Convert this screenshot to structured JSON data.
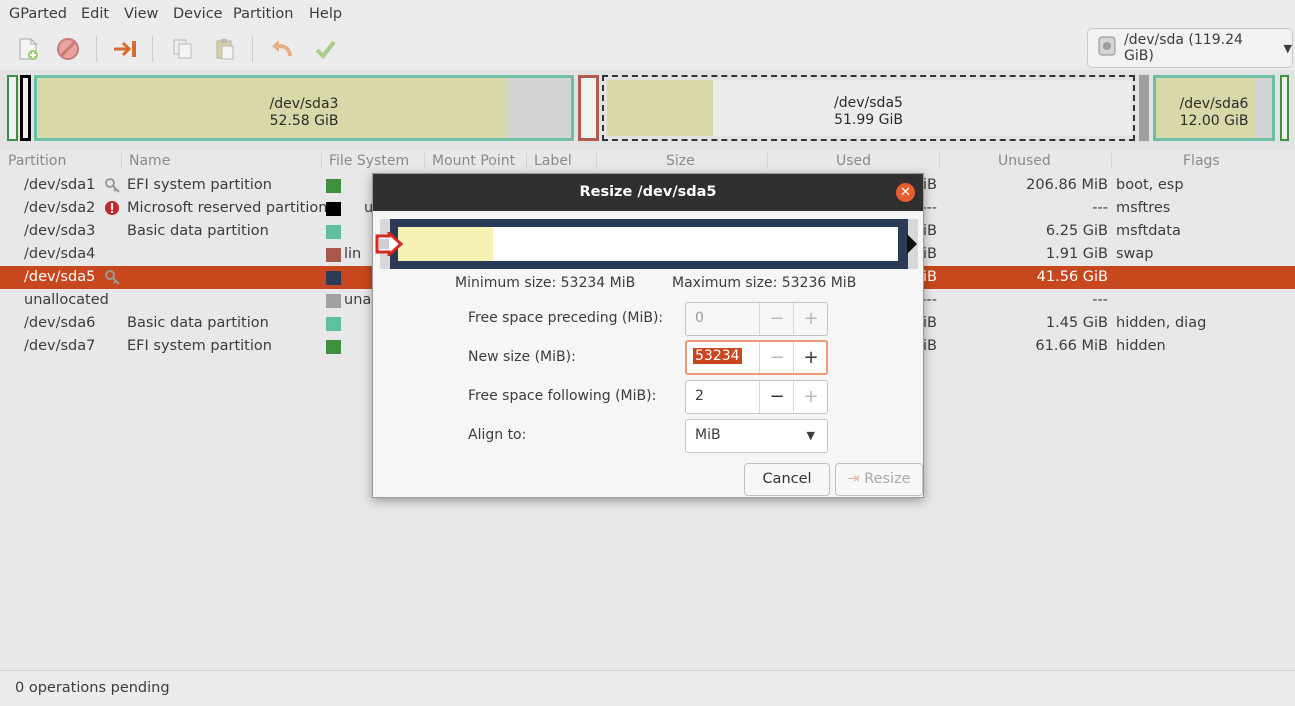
{
  "menu": [
    "GParted",
    "Edit",
    "View",
    "Device",
    "Partition",
    "Help"
  ],
  "toolbar": {
    "icons": [
      "new-icon",
      "delete-icon",
      "resize-move-icon",
      "copy-icon",
      "paste-icon",
      "undo-icon",
      "apply-icon"
    ]
  },
  "device_selector": {
    "label": "/dev/sda (119.24 GiB)"
  },
  "disk_map": {
    "sda3": {
      "name": "/dev/sda3",
      "size": "52.58 GiB"
    },
    "sda5": {
      "name": "/dev/sda5",
      "size": "51.99 GiB"
    },
    "sda6": {
      "name": "/dev/sda6",
      "size": "12.00 GiB"
    }
  },
  "table": {
    "headers": [
      "Partition",
      "Name",
      "File System",
      "Mount Point",
      "Label",
      "Size",
      "Used",
      "Unused",
      "Flags"
    ],
    "rows": [
      {
        "partition": "/dev/sda1",
        "icon": "key-icon",
        "name": "EFI system partition",
        "fs_color": "#3f8f3f",
        "fs": "",
        "used_frag": "iB",
        "unused": "206.86 MiB",
        "flags": "boot, esp"
      },
      {
        "partition": "/dev/sda2",
        "icon": "warning-icon",
        "name": "Microsoft reserved partition",
        "fs_color": "#000000",
        "fs": "u",
        "used_frag": "---",
        "unused": "---",
        "flags": "msftres"
      },
      {
        "partition": "/dev/sda3",
        "icon": "",
        "name": "Basic data partition",
        "fs_color": "#5fbf9f",
        "fs": "",
        "used_frag": "iB",
        "unused": "6.25 GiB",
        "flags": "msftdata"
      },
      {
        "partition": "/dev/sda4",
        "icon": "",
        "name": "",
        "fs_color": "#a85a4a",
        "fs": "lin",
        "used_frag": "iB",
        "unused": "1.91 GiB",
        "flags": "swap"
      },
      {
        "partition": "/dev/sda5",
        "icon": "key-icon",
        "name": "",
        "fs_color": "#2b3a57",
        "fs": "",
        "used_frag": "iB",
        "unused": "41.56 GiB",
        "flags": ""
      },
      {
        "partition": "unallocated",
        "icon": "",
        "name": "",
        "fs_color": "#a0a0a0",
        "fs": "unal",
        "used_frag": "---",
        "unused": "---",
        "flags": ""
      },
      {
        "partition": "/dev/sda6",
        "icon": "",
        "name": "Basic data partition",
        "fs_color": "#5fbf9f",
        "fs": "",
        "used_frag": "iB",
        "unused": "1.45 GiB",
        "flags": "hidden, diag"
      },
      {
        "partition": "/dev/sda7",
        "icon": "",
        "name": "EFI system partition",
        "fs_color": "#3f8f3f",
        "fs": "",
        "used_frag": "iB",
        "unused": "61.66 MiB",
        "flags": "hidden"
      }
    ],
    "selected_index": 4
  },
  "status": "0 operations pending",
  "dialog": {
    "title": "Resize /dev/sda5",
    "used_fraction": 0.19,
    "min_size": "Minimum size: 53234 MiB",
    "max_size": "Maximum size: 53236 MiB",
    "fields": [
      {
        "label": "Free space preceding (MiB):",
        "value": "0"
      },
      {
        "label": "New size (MiB):",
        "value": "53234"
      },
      {
        "label": "Free space following (MiB):",
        "value": "2"
      },
      {
        "label": "Align to:",
        "value": "MiB"
      }
    ],
    "cancel_label": "Cancel",
    "resize_label": "Resize"
  },
  "colors": {
    "accent": "#c7471e",
    "used_fill": "#d6d6a5",
    "ntfs": "#5fbf9f",
    "efi": "#3f8f3f"
  }
}
